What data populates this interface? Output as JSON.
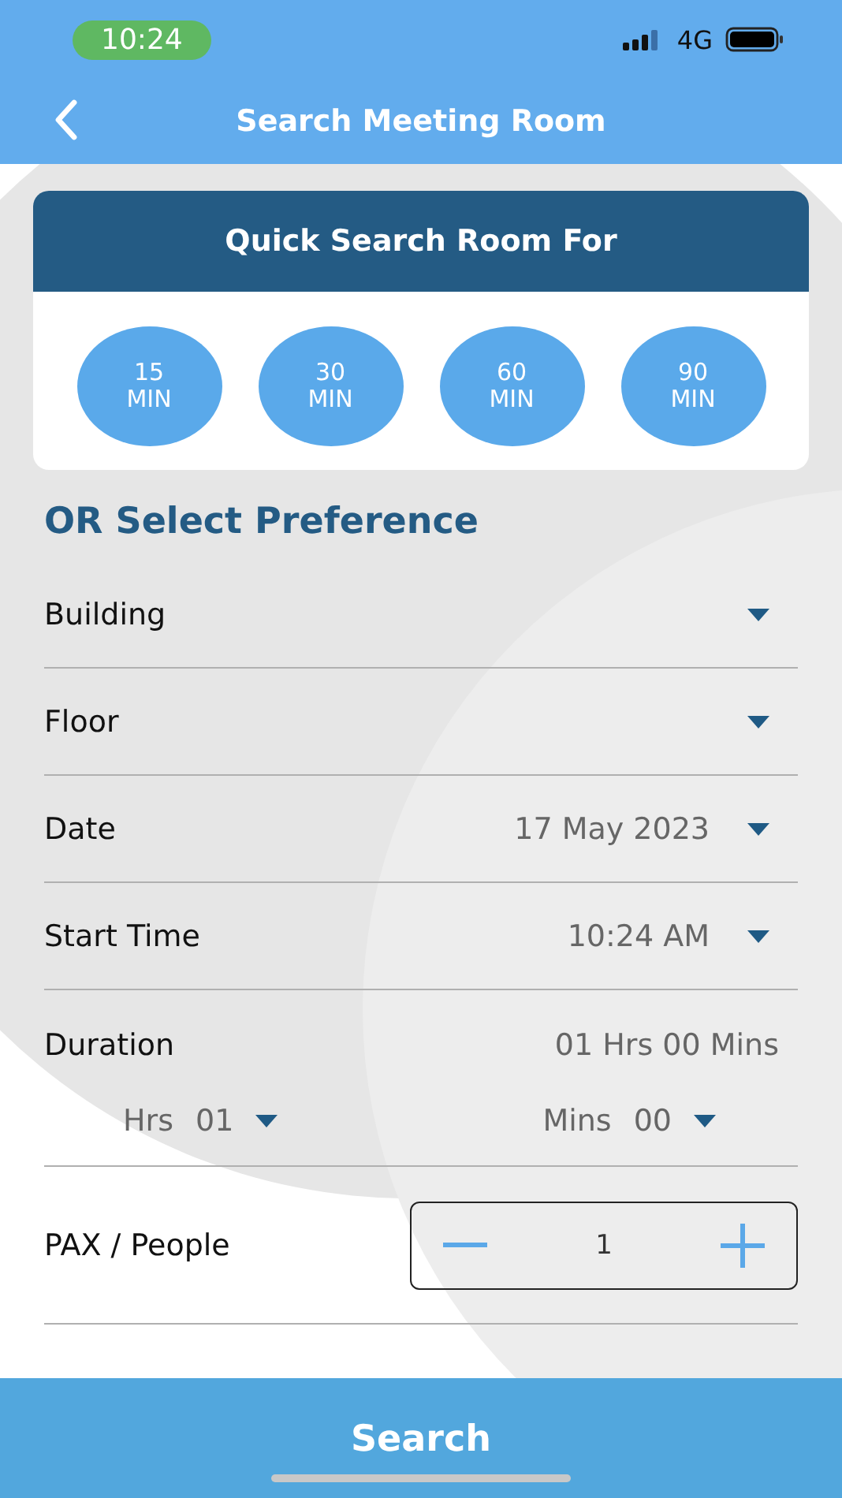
{
  "status_bar": {
    "time": "10:24",
    "network": "4G"
  },
  "header": {
    "title": "Search Meeting Room"
  },
  "quick_search": {
    "title": "Quick Search Room For",
    "options": [
      {
        "value": "15",
        "unit": "MIN"
      },
      {
        "value": "30",
        "unit": "MIN"
      },
      {
        "value": "60",
        "unit": "MIN"
      },
      {
        "value": "90",
        "unit": "MIN"
      }
    ]
  },
  "preference_title": "OR Select Preference",
  "fields": [
    {
      "label": "Building"
    },
    {
      "label": "Floor"
    },
    {
      "label": "Date",
      "value": "17 May 2023"
    },
    {
      "label": "Start Time",
      "value": "10:24 AM"
    }
  ],
  "duration": {
    "label": "Duration",
    "value": "01 Hrs 00 Mins",
    "hours_label": "Hrs",
    "hours": "01",
    "mins_label": "Mins",
    "mins": "00"
  },
  "pax": {
    "label": "PAX / People",
    "value": "1"
  },
  "search_button": "Search"
}
